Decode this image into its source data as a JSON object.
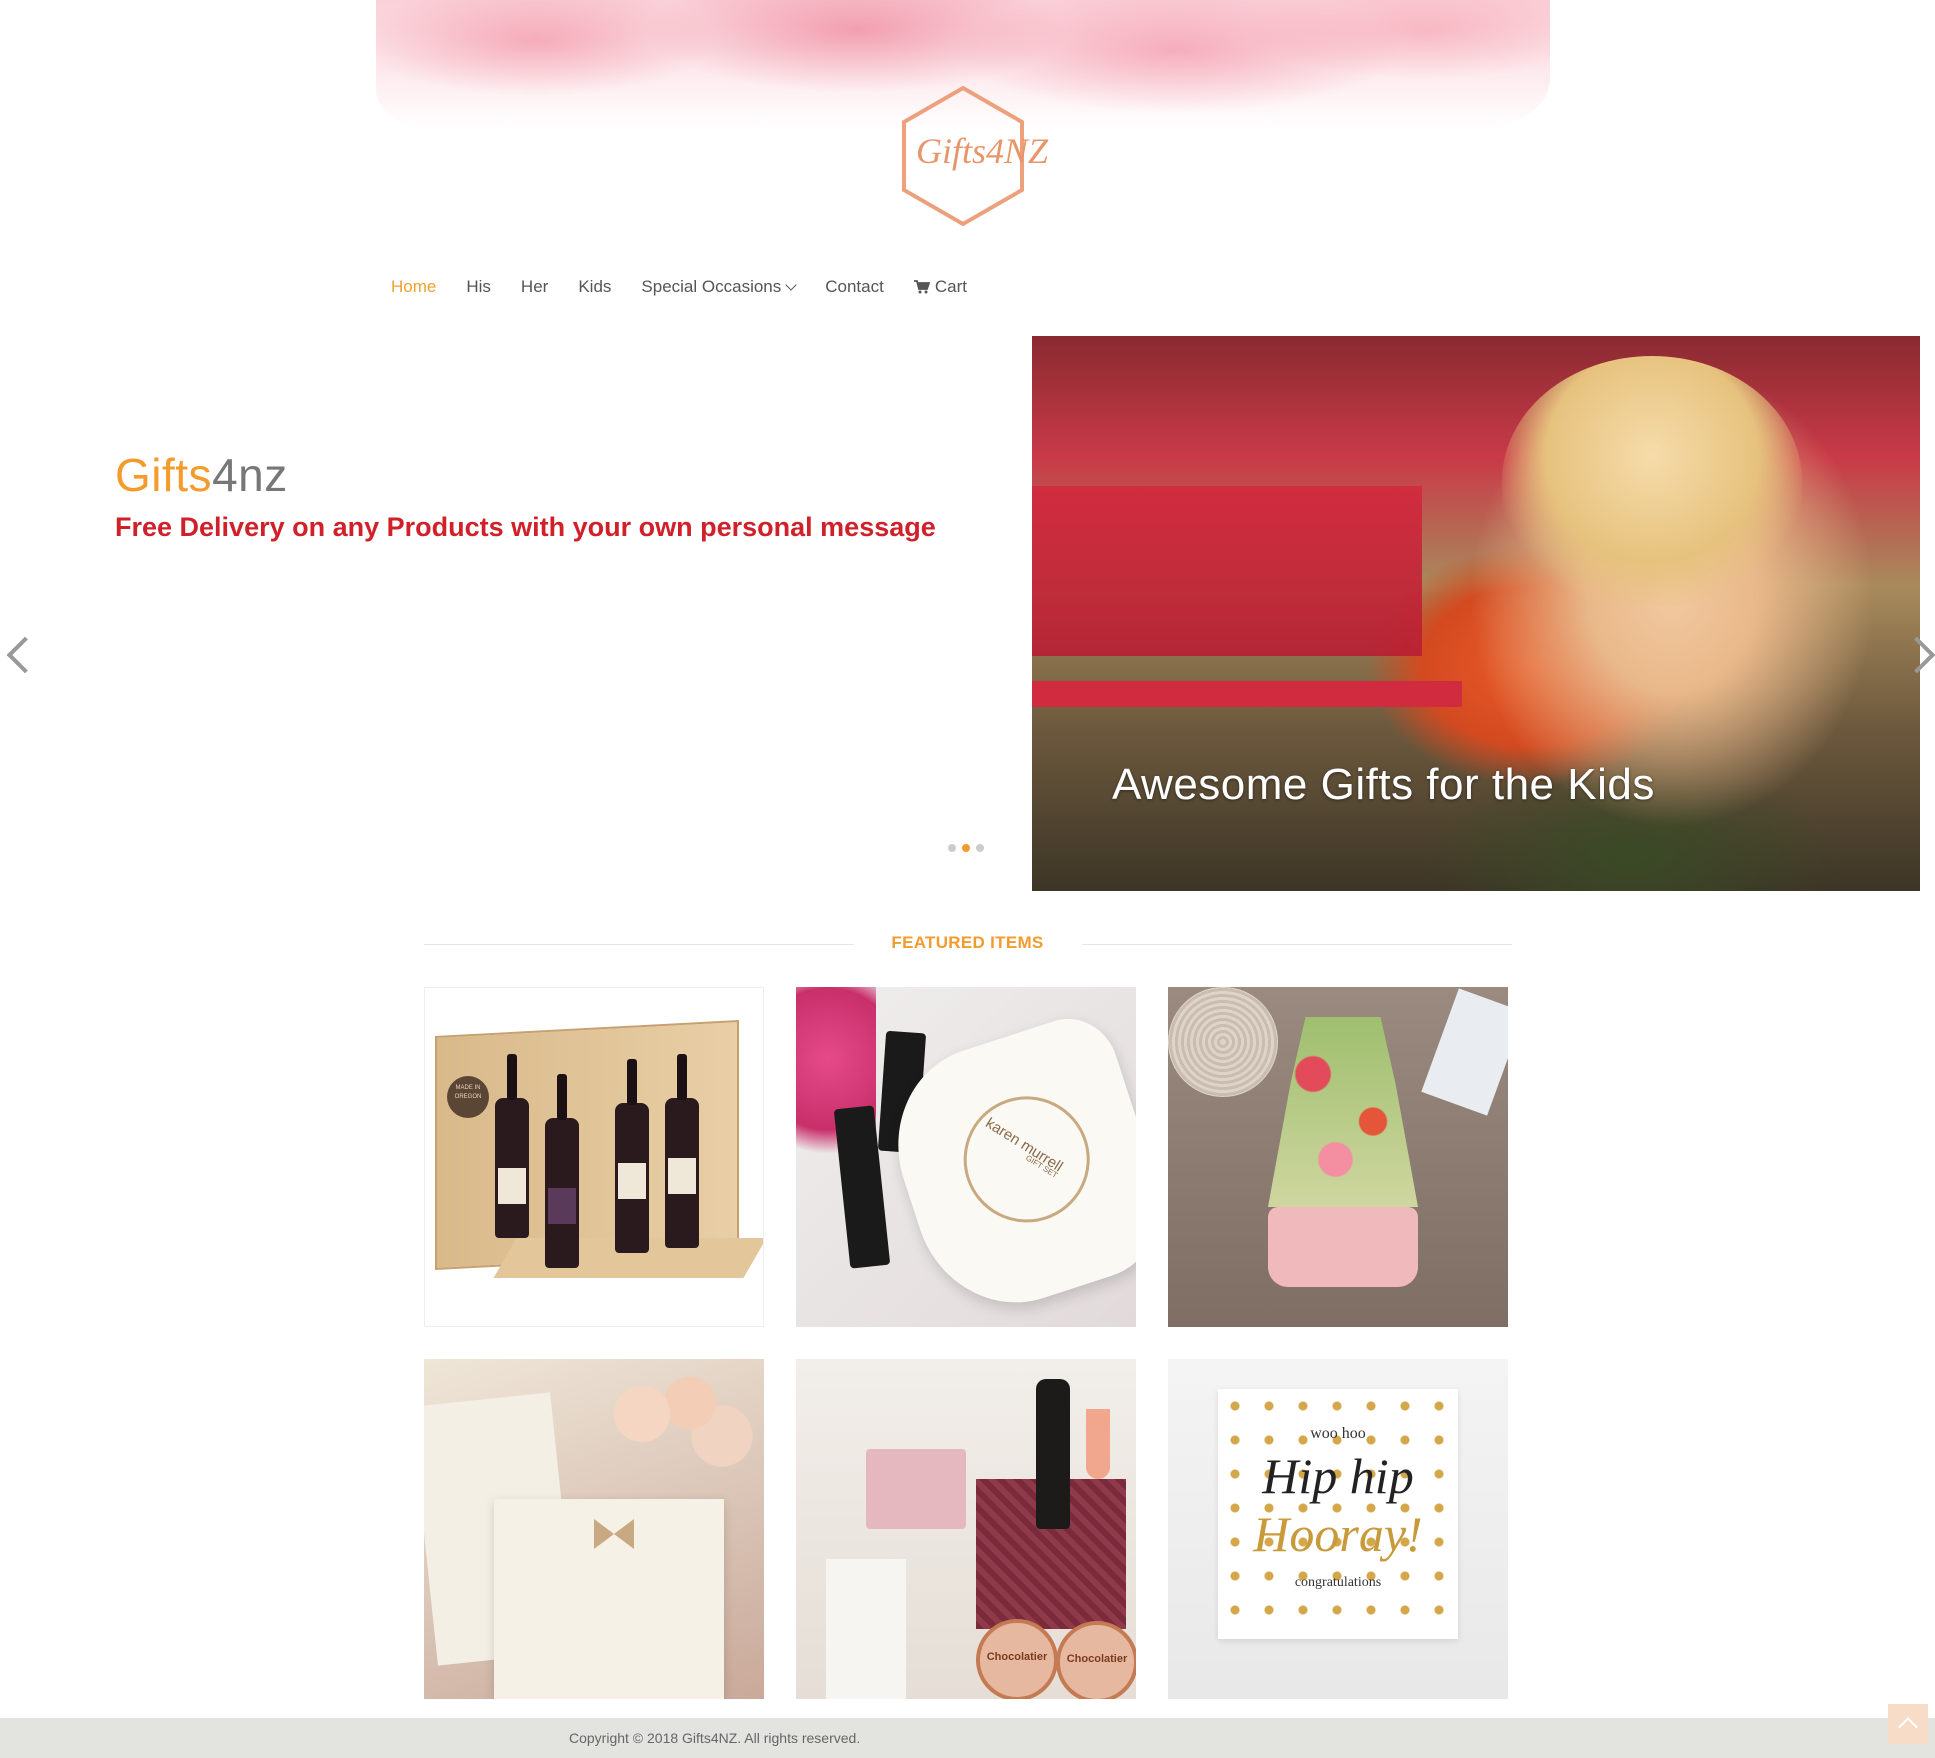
{
  "header": {
    "logo_text": "Gifts4NZ",
    "logo_color": "#e8956a"
  },
  "nav": {
    "items": [
      {
        "label": "Home",
        "active": true
      },
      {
        "label": "His",
        "active": false
      },
      {
        "label": "Her",
        "active": false
      },
      {
        "label": "Kids",
        "active": false
      },
      {
        "label": "Special Occasions",
        "active": false,
        "icon": "chevron-down-icon"
      },
      {
        "label": "Contact",
        "active": false
      },
      {
        "label": "Cart",
        "active": false,
        "icon": "shopping-cart-icon"
      }
    ]
  },
  "hero": {
    "brand_part1": "Gifts",
    "brand_part2": "4nz",
    "promo_text": "Free Delivery on any Products with your own personal message",
    "slide_caption": "Awesome Gifts for the Kids",
    "active_slide": 2,
    "slide_count": 3
  },
  "featured": {
    "title": "FEATURED ITEMS",
    "items": [
      {
        "alt": "wine gift box",
        "box_text": "MADE IN OREGON"
      },
      {
        "alt": "karen murrell gift set",
        "box_text": "karen murrell",
        "box_subtext": "GIFT SET"
      },
      {
        "alt": "girls floral outfit"
      },
      {
        "alt": "wedding invitation"
      },
      {
        "alt": "champagne hamper",
        "tin_text": "Chocolatier"
      },
      {
        "alt": "congratulations card",
        "line1": "woo hoo",
        "line2": "Hip hip",
        "line3": "Hooray!",
        "line4": "congratulations"
      }
    ]
  },
  "footer": {
    "copyright": "Copyright © 2018 Gifts4NZ. All rights reserved."
  },
  "colors": {
    "accent": "#f39b2c",
    "promo": "#d0202a",
    "footer_bg": "#e3e3e0"
  }
}
